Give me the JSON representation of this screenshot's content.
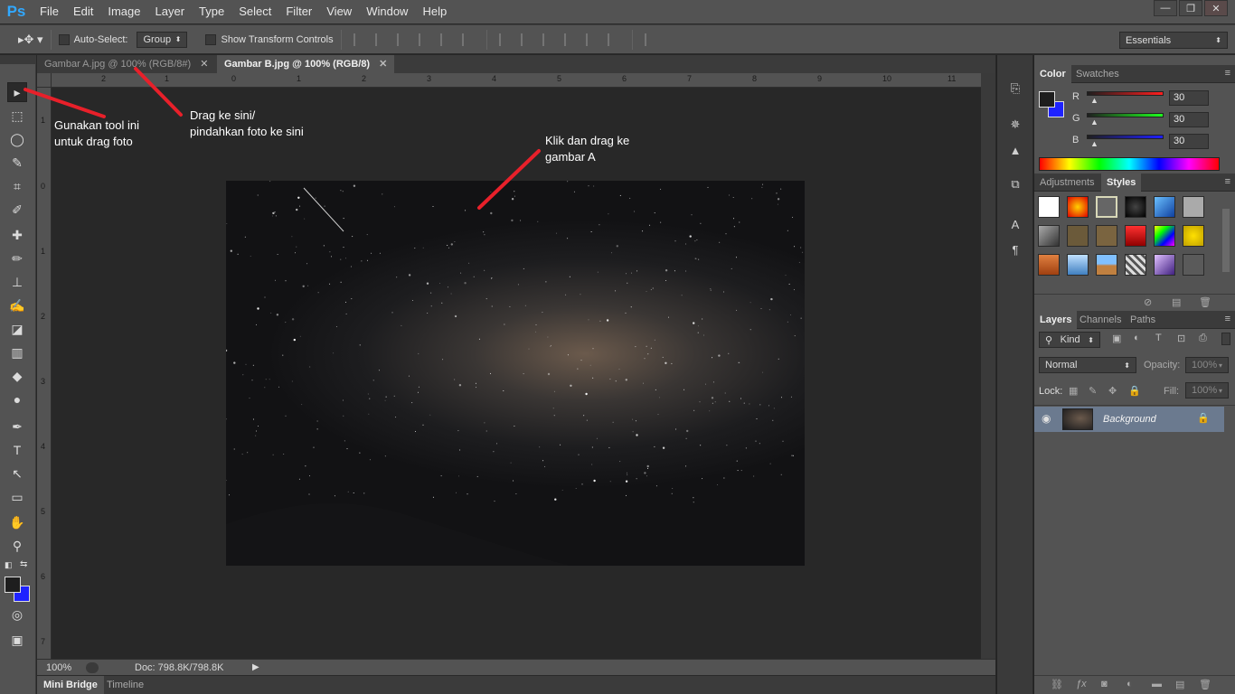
{
  "app": {
    "logo": "Ps",
    "menu": [
      "File",
      "Edit",
      "Image",
      "Layer",
      "Type",
      "Select",
      "Filter",
      "View",
      "Window",
      "Help"
    ],
    "window_controls": [
      "—",
      "❐",
      "✕"
    ]
  },
  "options_bar": {
    "auto_select_label": "Auto-Select:",
    "auto_select_value": "Group",
    "show_transform_label": "Show Transform Controls",
    "workspace_value": "Essentials"
  },
  "documents": {
    "tabs": [
      {
        "label": "Gambar A.jpg @ 100% (RGB/8#)",
        "close": "✕"
      },
      {
        "label": "Gambar B.jpg @ 100% (RGB/8)",
        "close": "✕"
      }
    ]
  },
  "rulers": {
    "horizontal": [
      "2",
      "1",
      "0",
      "1",
      "2",
      "3",
      "4",
      "5",
      "6",
      "7",
      "8",
      "9",
      "10",
      "11"
    ],
    "vertical": [
      "1",
      "0",
      "1",
      "2",
      "3",
      "4",
      "5",
      "6",
      "7"
    ]
  },
  "status": {
    "zoom": "100%",
    "doc": "Doc: 798.8K/798.8K"
  },
  "bottom_tabs": [
    "Mini Bridge",
    "Timeline"
  ],
  "color_panel": {
    "tabs": [
      "Color",
      "Swatches"
    ],
    "channels": [
      {
        "label": "R",
        "value": "30"
      },
      {
        "label": "G",
        "value": "30"
      },
      {
        "label": "B",
        "value": "30"
      }
    ]
  },
  "styles_panel": {
    "tabs": [
      "Adjustments",
      "Styles"
    ]
  },
  "layers_panel": {
    "tabs": [
      "Layers",
      "Channels",
      "Paths"
    ],
    "filter_kind": "Kind",
    "blend_mode": "Normal",
    "opacity_label": "Opacity:",
    "opacity_value": "100%",
    "lock_label": "Lock:",
    "fill_label": "Fill:",
    "fill_value": "100%",
    "layer_name": "Background"
  },
  "annotations": {
    "tool_note": [
      "Gunakan tool ini",
      "untuk drag foto"
    ],
    "drag_note": [
      "Drag ke sini/",
      "pindahkan foto ke sini"
    ],
    "click_note": [
      "Klik dan drag ke",
      "gambar A"
    ]
  },
  "colors": {
    "ui_dark": "#282828",
    "ui_mid": "#535353",
    "annotation_red": "#e8202a",
    "background_color_swatch": "#1e22ff",
    "foreground_color_swatch": "#1e1e1e"
  }
}
